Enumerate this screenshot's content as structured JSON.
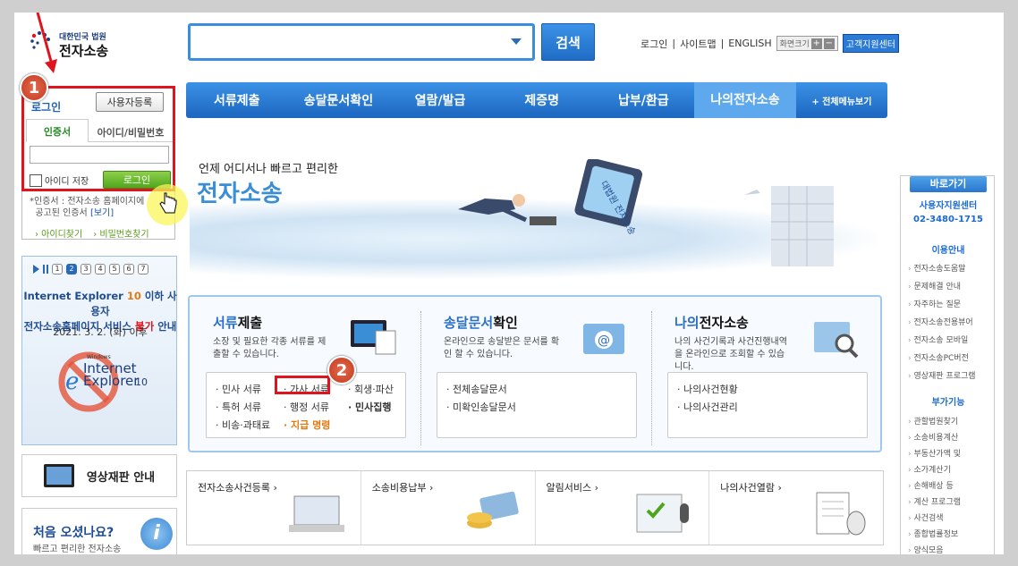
{
  "header": {
    "logo_line1": "대한민국 법원",
    "logo_line2": "전자소송",
    "search_value": "",
    "search_button": "검색",
    "util_login": "로그인",
    "util_sitemap": "사이트맵",
    "util_english": "ENGLISH",
    "zoom_label": "화면크기",
    "zoom_plus": "+",
    "zoom_minus": "−",
    "help_center": "고객지원센터"
  },
  "nav": {
    "items": [
      "서류제출",
      "송달문서확인",
      "열람/발급",
      "제증명",
      "납부/환급",
      "나의전자소송",
      "+ 전체메뉴보기"
    ]
  },
  "login": {
    "title": "로그인",
    "register": "사용자등록",
    "tab_cert": "인증서",
    "tab_id": "아이디/비밀번호",
    "save_id": "아이디 저장",
    "login_button": "로그인",
    "note_prefix": "*인증서 : 전자소송 홈페이지에",
    "note_line2": "공고된 인증서",
    "note_link": "[보기]",
    "find_id": "› 아이디찾기",
    "find_pw": "› 비밀번호찾기"
  },
  "ie_banner": {
    "pages": [
      "1",
      "2",
      "3",
      "4",
      "5",
      "6",
      "7"
    ],
    "active_page": "2",
    "line1_a": "Internet Explorer ",
    "line1_b": "10",
    "line1_c": " 이하 사용자",
    "line2_a": "전자소송홈페이지 서비스 ",
    "line2_b": "불가",
    "line2_c": " 안내",
    "date": "2021. 3. 2. (화) 이후",
    "logo_small": "Windows",
    "logo_big1": "Internet",
    "logo_big2": "Explorer",
    "logo_ver": "10"
  },
  "video": {
    "label": "영상재판 안내"
  },
  "first_visit": {
    "title": "처음 오셨나요?",
    "subtitle": "빠르고 편리한 전자소송",
    "icon": "i"
  },
  "hero": {
    "tagline": "언제 어디서나 빠르고 편리한",
    "title": "전자소송",
    "sign": "대법원 전자소송"
  },
  "services": [
    {
      "title_a": "서류",
      "title_b": "제출",
      "desc": "소장 및 필요한 각종 서류를 제출할 수 있습니다.",
      "items": [
        "· 민사 서류",
        "· 가사 서류",
        "· 회생·파산",
        "· 특허 서류",
        "· 행정 서류",
        "· 민사집행",
        "· 비송·과태료",
        "· 지급 명령"
      ]
    },
    {
      "title_a": "송달문서",
      "title_b": "확인",
      "desc": "온라인으로 송달받은 문서를 확인 할 수 있습니다.",
      "items": [
        "· 전체송달문서",
        "· 미확인송달문서"
      ]
    },
    {
      "title_a": "나의",
      "title_b": "전자소송",
      "desc": "나의 사건기록과 사건진행내역을 온라인으로 조회할 수 있습니다.",
      "items": [
        "· 나의사건현황",
        "· 나의사건관리"
      ]
    }
  ],
  "shortcuts": [
    "전자소송사건등록 ›",
    "소송비용납부 ›",
    "알림서비스 ›",
    "나의사건열람 ›"
  ],
  "sidebar": {
    "title": "바로가기",
    "help_line1": "사용자지원센터",
    "help_line2": "02-3480-1715",
    "section1": "이용안내",
    "items1": [
      "전자소송도움말",
      "문제해결 안내",
      "자주하는 질문",
      "전자소송전용뷰어",
      "전자소송 모바일",
      "전자소송PC버전",
      "영상재판 프로그램"
    ],
    "section2": "부가기능",
    "items2": [
      "관할법원찾기",
      "소송비용계산",
      "부동산가액 및",
      "소가계산기",
      "손해배상 등",
      "계산 프로그램",
      "사건검색",
      "종합법률정보",
      "양식모음"
    ]
  },
  "annotations": {
    "step1": "1",
    "step2": "2"
  },
  "colors": {
    "primary": "#2a7ad6",
    "accent_red": "#e0141e",
    "green": "#4fa51d"
  }
}
